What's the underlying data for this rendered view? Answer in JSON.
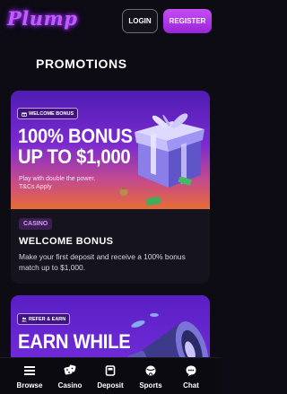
{
  "header": {
    "logo_text": "Plump",
    "login_label": "LOGIN",
    "register_label": "REGISTER"
  },
  "page_title": "PROMOTIONS",
  "promotions": [
    {
      "tag_icon": "gift-icon",
      "tag": "WELCOME BONUS",
      "headline_line1": "100% BONUS",
      "headline_line2": "UP TO $1,000",
      "subline1": "Play with double the power.",
      "subline2": "T&Cs Apply",
      "category": "CASINO",
      "title": "WELCOME BONUS",
      "description": "Make your first deposit and receive a 100% bonus match up to $1,000."
    },
    {
      "tag_icon": "people-icon",
      "tag": "REFER & EARN",
      "headline_line1": "EARN WHILE"
    }
  ],
  "bottom_nav": [
    {
      "label": "Browse",
      "icon": "menu-icon"
    },
    {
      "label": "Casino",
      "icon": "dice-icon"
    },
    {
      "label": "Deposit",
      "icon": "wallet-icon"
    },
    {
      "label": "Sports",
      "icon": "ball-icon"
    },
    {
      "label": "Chat",
      "icon": "chat-bubble-icon"
    }
  ],
  "colors": {
    "background": "#0d0b14",
    "accent": "#b43bf0",
    "logo": "#c35bff",
    "card": "#15131d"
  }
}
